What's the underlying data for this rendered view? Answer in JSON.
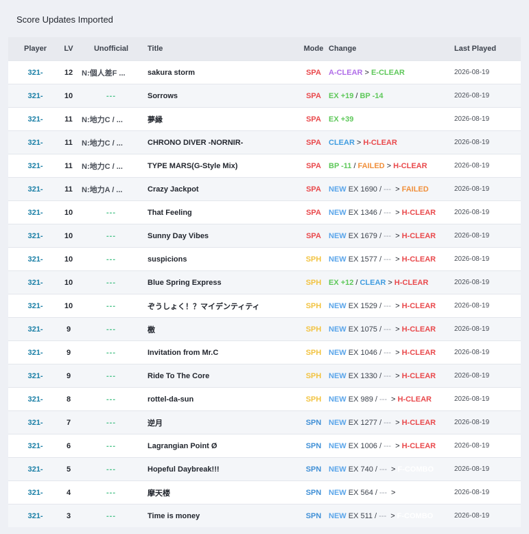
{
  "section_title": "Score Updates Imported",
  "columns": {
    "player": "Player",
    "lv": "LV",
    "unofficial": "Unofficial",
    "title": "Title",
    "mode": "Mode",
    "change": "Change",
    "last_played": "Last Played"
  },
  "colors": {
    "player": "#1a7fa6",
    "SPA": "#e9494c",
    "SPH": "#f2c341",
    "SPN": "#3f8fd6",
    "NEW": "#5aa5ea",
    "A-CLEAR": "#b06ee8",
    "E-CLEAR": "#5ec85a",
    "CLEAR": "#3f9ce0",
    "H-CLEAR": "#e9494c",
    "FAILED": "#f0903c",
    "F-COMBO": "#ffffff",
    "delta": "#5ec85a",
    "unofficial_dash": "#4cc38a"
  },
  "rows": [
    {
      "player": "321-",
      "lv": "12",
      "unofficial": "N:個人差F ...",
      "title": "sakura storm",
      "mode": "SPA",
      "last_played": "2026-08-19",
      "change": [
        {
          "t": "A-CLEAR",
          "c": "A-CLEAR"
        },
        {
          "t": ">",
          "c": "sep"
        },
        {
          "t": "E-CLEAR",
          "c": "E-CLEAR"
        }
      ]
    },
    {
      "player": "321-",
      "lv": "10",
      "unofficial": "---",
      "title": "Sorrows",
      "mode": "SPA",
      "last_played": "2026-08-19",
      "change": [
        {
          "t": "EX +19",
          "c": "delta"
        },
        {
          "t": "/",
          "c": "sep"
        },
        {
          "t": "BP -14",
          "c": "delta"
        }
      ]
    },
    {
      "player": "321-",
      "lv": "11",
      "unofficial": "N:地力C / ...",
      "title": "夢縁",
      "mode": "SPA",
      "last_played": "2026-08-19",
      "change": [
        {
          "t": "EX +39",
          "c": "delta"
        }
      ]
    },
    {
      "player": "321-",
      "lv": "11",
      "unofficial": "N:地力C / ...",
      "title": "CHRONO DIVER -NORNIR-",
      "mode": "SPA",
      "last_played": "2026-08-19",
      "change": [
        {
          "t": "CLEAR",
          "c": "CLEAR"
        },
        {
          "t": ">",
          "c": "sep"
        },
        {
          "t": "H-CLEAR",
          "c": "H-CLEAR"
        }
      ]
    },
    {
      "player": "321-",
      "lv": "11",
      "unofficial": "N:地力C / ...",
      "title": "TYPE MARS(G-Style Mix)",
      "mode": "SPA",
      "last_played": "2026-08-19",
      "change": [
        {
          "t": "BP -11",
          "c": "delta"
        },
        {
          "t": "/",
          "c": "sep"
        },
        {
          "t": "FAILED",
          "c": "FAILED"
        },
        {
          "t": ">",
          "c": "sep"
        },
        {
          "t": "H-CLEAR",
          "c": "H-CLEAR"
        }
      ]
    },
    {
      "player": "321-",
      "lv": "11",
      "unofficial": "N:地力A / ...",
      "title": "Crazy Jackpot",
      "mode": "SPA",
      "last_played": "2026-08-19",
      "change": [
        {
          "t": "NEW",
          "c": "NEW"
        },
        {
          "t": " EX 1690 /",
          "c": "plain"
        },
        {
          "t": " --- ",
          "c": "gray"
        },
        {
          "t": ">",
          "c": "sep"
        },
        {
          "t": "FAILED",
          "c": "FAILED"
        }
      ]
    },
    {
      "player": "321-",
      "lv": "10",
      "unofficial": "---",
      "title": "That Feeling",
      "mode": "SPA",
      "last_played": "2026-08-19",
      "change": [
        {
          "t": "NEW",
          "c": "NEW"
        },
        {
          "t": " EX 1346 /",
          "c": "plain"
        },
        {
          "t": " --- ",
          "c": "gray"
        },
        {
          "t": ">",
          "c": "sep"
        },
        {
          "t": "H-CLEAR",
          "c": "H-CLEAR"
        }
      ]
    },
    {
      "player": "321-",
      "lv": "10",
      "unofficial": "---",
      "title": "Sunny Day Vibes",
      "mode": "SPA",
      "last_played": "2026-08-19",
      "change": [
        {
          "t": "NEW",
          "c": "NEW"
        },
        {
          "t": " EX 1679 /",
          "c": "plain"
        },
        {
          "t": " --- ",
          "c": "gray"
        },
        {
          "t": ">",
          "c": "sep"
        },
        {
          "t": "H-CLEAR",
          "c": "H-CLEAR"
        }
      ]
    },
    {
      "player": "321-",
      "lv": "10",
      "unofficial": "---",
      "title": "suspicions",
      "mode": "SPH",
      "last_played": "2026-08-19",
      "change": [
        {
          "t": "NEW",
          "c": "NEW"
        },
        {
          "t": " EX 1577 /",
          "c": "plain"
        },
        {
          "t": " --- ",
          "c": "gray"
        },
        {
          "t": ">",
          "c": "sep"
        },
        {
          "t": "H-CLEAR",
          "c": "H-CLEAR"
        }
      ]
    },
    {
      "player": "321-",
      "lv": "10",
      "unofficial": "---",
      "title": "Blue Spring Express",
      "mode": "SPH",
      "last_played": "2026-08-19",
      "change": [
        {
          "t": "EX +12",
          "c": "delta"
        },
        {
          "t": "/",
          "c": "sep"
        },
        {
          "t": "CLEAR",
          "c": "CLEAR"
        },
        {
          "t": ">",
          "c": "sep"
        },
        {
          "t": "H-CLEAR",
          "c": "H-CLEAR"
        }
      ]
    },
    {
      "player": "321-",
      "lv": "10",
      "unofficial": "---",
      "title": "ぞうしょく！？マイデンティティ",
      "mode": "SPH",
      "last_played": "2026-08-19",
      "change": [
        {
          "t": "NEW",
          "c": "NEW"
        },
        {
          "t": " EX 1529 /",
          "c": "plain"
        },
        {
          "t": " --- ",
          "c": "gray"
        },
        {
          "t": ">",
          "c": "sep"
        },
        {
          "t": "H-CLEAR",
          "c": "H-CLEAR"
        }
      ]
    },
    {
      "player": "321-",
      "lv": "9",
      "unofficial": "---",
      "title": "檄",
      "mode": "SPH",
      "last_played": "2026-08-19",
      "change": [
        {
          "t": "NEW",
          "c": "NEW"
        },
        {
          "t": " EX 1075 /",
          "c": "plain"
        },
        {
          "t": " --- ",
          "c": "gray"
        },
        {
          "t": ">",
          "c": "sep"
        },
        {
          "t": "H-CLEAR",
          "c": "H-CLEAR"
        }
      ]
    },
    {
      "player": "321-",
      "lv": "9",
      "unofficial": "---",
      "title": "Invitation from Mr.C",
      "mode": "SPH",
      "last_played": "2026-08-19",
      "change": [
        {
          "t": "NEW",
          "c": "NEW"
        },
        {
          "t": " EX 1046 /",
          "c": "plain"
        },
        {
          "t": " --- ",
          "c": "gray"
        },
        {
          "t": ">",
          "c": "sep"
        },
        {
          "t": "H-CLEAR",
          "c": "H-CLEAR"
        }
      ]
    },
    {
      "player": "321-",
      "lv": "9",
      "unofficial": "---",
      "title": "Ride To The Core",
      "mode": "SPH",
      "last_played": "2026-08-19",
      "change": [
        {
          "t": "NEW",
          "c": "NEW"
        },
        {
          "t": " EX 1330 /",
          "c": "plain"
        },
        {
          "t": " --- ",
          "c": "gray"
        },
        {
          "t": ">",
          "c": "sep"
        },
        {
          "t": "H-CLEAR",
          "c": "H-CLEAR"
        }
      ]
    },
    {
      "player": "321-",
      "lv": "8",
      "unofficial": "---",
      "title": "rottel-da-sun",
      "mode": "SPH",
      "last_played": "2026-08-19",
      "change": [
        {
          "t": "NEW",
          "c": "NEW"
        },
        {
          "t": " EX 989 /",
          "c": "plain"
        },
        {
          "t": " --- ",
          "c": "gray"
        },
        {
          "t": ">",
          "c": "sep"
        },
        {
          "t": "H-CLEAR",
          "c": "H-CLEAR"
        }
      ]
    },
    {
      "player": "321-",
      "lv": "7",
      "unofficial": "---",
      "title": "逆月",
      "mode": "SPN",
      "last_played": "2026-08-19",
      "change": [
        {
          "t": "NEW",
          "c": "NEW"
        },
        {
          "t": " EX 1277 /",
          "c": "plain"
        },
        {
          "t": " --- ",
          "c": "gray"
        },
        {
          "t": ">",
          "c": "sep"
        },
        {
          "t": "H-CLEAR",
          "c": "H-CLEAR"
        }
      ]
    },
    {
      "player": "321-",
      "lv": "6",
      "unofficial": "---",
      "title": "Lagrangian Point Ø",
      "mode": "SPN",
      "last_played": "2026-08-19",
      "change": [
        {
          "t": "NEW",
          "c": "NEW"
        },
        {
          "t": " EX 1006 /",
          "c": "plain"
        },
        {
          "t": " --- ",
          "c": "gray"
        },
        {
          "t": ">",
          "c": "sep"
        },
        {
          "t": "H-CLEAR",
          "c": "H-CLEAR"
        }
      ]
    },
    {
      "player": "321-",
      "lv": "5",
      "unofficial": "---",
      "title": "Hopeful Daybreak!!!",
      "mode": "SPN",
      "last_played": "2026-08-19",
      "change": [
        {
          "t": "NEW",
          "c": "NEW"
        },
        {
          "t": " EX 740 /",
          "c": "plain"
        },
        {
          "t": " --- ",
          "c": "gray"
        },
        {
          "t": ">",
          "c": "sep"
        },
        {
          "t": "F-COMBO",
          "c": "F-COMBO"
        }
      ]
    },
    {
      "player": "321-",
      "lv": "4",
      "unofficial": "---",
      "title": "摩天楼",
      "mode": "SPN",
      "last_played": "2026-08-19",
      "change": [
        {
          "t": "NEW",
          "c": "NEW"
        },
        {
          "t": " EX 564 /",
          "c": "plain"
        },
        {
          "t": " --- ",
          "c": "gray"
        },
        {
          "t": ">",
          "c": "sep"
        }
      ]
    },
    {
      "player": "321-",
      "lv": "3",
      "unofficial": "---",
      "title": "Time is money",
      "mode": "SPN",
      "last_played": "2026-08-19",
      "change": [
        {
          "t": "NEW",
          "c": "NEW"
        },
        {
          "t": " EX 511 /",
          "c": "plain"
        },
        {
          "t": " --- ",
          "c": "gray"
        },
        {
          "t": ">",
          "c": "sep"
        },
        {
          "t": "F-COMBO",
          "c": "F-COMBO"
        }
      ]
    }
  ]
}
